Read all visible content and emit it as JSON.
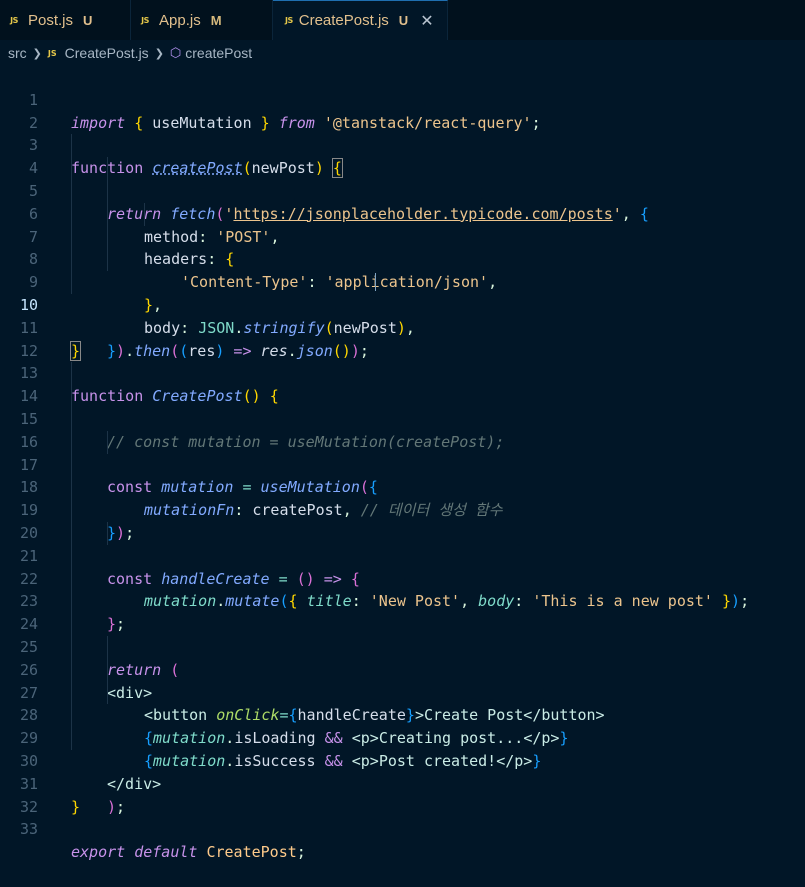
{
  "tabs": [
    {
      "name": "Post.js",
      "status": "U",
      "icon": "js-file-icon"
    },
    {
      "name": "App.js",
      "status": "M",
      "icon": "js-file-icon"
    },
    {
      "name": "CreatePost.js",
      "status": "U",
      "icon": "js-file-icon",
      "active": true,
      "close": "✕"
    }
  ],
  "breadcrumb": {
    "folder": "src",
    "file": "CreatePost.js",
    "symbol": "createPost",
    "js_badge": "JS"
  },
  "editor": {
    "current_line": 10,
    "line_numbers": [
      "1",
      "2",
      "3",
      "4",
      "5",
      "6",
      "7",
      "8",
      "9",
      "10",
      "11",
      "12",
      "13",
      "14",
      "15",
      "16",
      "17",
      "18",
      "19",
      "20",
      "21",
      "22",
      "23",
      "24",
      "25",
      "26",
      "27",
      "28",
      "29",
      "30",
      "31",
      "32",
      "33"
    ],
    "code": {
      "l1": {
        "a": "import",
        "b": " { ",
        "c": "useMutation",
        "d": " } ",
        "e": "from",
        "f": " ",
        "g": "'@tanstack/react-query'",
        "h": ";"
      },
      "l3": {
        "a": "function",
        "b": " ",
        "c": "createPost",
        "d": "(",
        "e": "newPost",
        "f": ")",
        "g": " ",
        "h": "{"
      },
      "l4": {
        "a": "return",
        "b": " ",
        "c": "fetch",
        "d": "(",
        "e": "'",
        "f": "https://jsonplaceholder.typicode.com/posts",
        "g": "'",
        "h": ", ",
        "i": "{"
      },
      "l5": {
        "a": "method",
        "b": ": ",
        "c": "'POST'",
        "d": ","
      },
      "l6": {
        "a": "headers",
        "b": ": ",
        "c": "{"
      },
      "l7": {
        "a": "'Content-Type'",
        "b": ": ",
        "c": "'application/json'",
        "d": ","
      },
      "l8": {
        "a": "}",
        "b": ","
      },
      "l9": {
        "a": "body",
        "b": ": ",
        "c": "JSON",
        "d": ".",
        "e": "stringify",
        "f": "(",
        "g": "newPost",
        "h": ")",
        "i": ","
      },
      "l10": {
        "a": "}",
        "b": ")",
        "c": ".",
        "d": "then",
        "e": "(",
        "f": "(",
        "g": "res",
        "h": ")",
        "i": " => ",
        "j": "res",
        "k": ".",
        "l": "json",
        "m": "()",
        "n": ")",
        "o": ";"
      },
      "l11": {
        "a": "}"
      },
      "l13": {
        "a": "function",
        "b": " ",
        "c": "CreatePost",
        "d": "()",
        "e": " ",
        "f": "{"
      },
      "l14": {
        "a": "// const mutation = useMutation(createPost);"
      },
      "l16": {
        "a": "const",
        "b": " ",
        "c": "mutation",
        "d": " = ",
        "e": "useMutation",
        "f": "(",
        "g": "{"
      },
      "l17": {
        "a": "mutationFn",
        "b": ": ",
        "c": "createPost",
        "d": ", ",
        "e": "// 데이터 생성 함수"
      },
      "l18": {
        "a": "}",
        "b": ")",
        "c": ";"
      },
      "l20": {
        "a": "const",
        "b": " ",
        "c": "handleCreate",
        "d": " = ",
        "e": "()",
        "f": " => ",
        "g": "{"
      },
      "l21": {
        "a": "mutation",
        "b": ".",
        "c": "mutate",
        "d": "(",
        "e": "{",
        "f": " ",
        "g": "title",
        "h": ": ",
        "i": "'New Post'",
        "j": ", ",
        "k": "body",
        "l": ": ",
        "m": "'This is a new post'",
        "n": " ",
        "o": "}",
        "p": ")",
        "q": ";"
      },
      "l22": {
        "a": "}",
        "b": ";"
      },
      "l24": {
        "a": "return",
        "b": " ",
        "c": "("
      },
      "l25": {
        "a": "<div>"
      },
      "l26": {
        "a": "<button ",
        "b": "onClick",
        "c": "=",
        "d": "{",
        "e": "handleCreate",
        "f": "}",
        "g": ">Create Post</button>"
      },
      "l27": {
        "a": "{",
        "b": "mutation",
        "c": ".",
        "d": "isLoading",
        "e": " && ",
        "f": "<p>",
        "g": "Creating post...",
        "h": "</p>",
        "i": "}"
      },
      "l28": {
        "a": "{",
        "b": "mutation",
        "c": ".",
        "d": "isSuccess",
        "e": " && ",
        "f": "<p>",
        "g": "Post created!",
        "h": "</p>",
        "i": "}"
      },
      "l29": {
        "a": "</div>"
      },
      "l30": {
        "a": ")",
        "b": ";"
      },
      "l31": {
        "a": "}"
      },
      "l33": {
        "a": "export",
        "b": " ",
        "c": "default",
        "d": " ",
        "e": "CreatePost",
        "f": ";"
      }
    }
  },
  "colors": {
    "background": "#011627",
    "keyword": "#c792ea",
    "function": "#82aaff",
    "string": "#ecc48d",
    "property": "#7fdbca",
    "comment": "#637777"
  }
}
